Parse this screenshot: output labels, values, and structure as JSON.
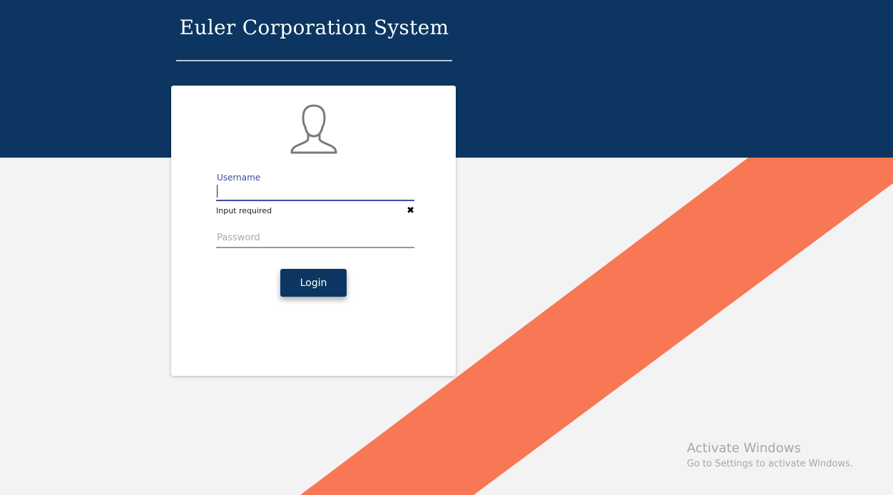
{
  "app": {
    "title": "Euler Corporation System"
  },
  "login_form": {
    "avatar_icon": "user-avatar-icon",
    "username": {
      "label": "Username",
      "value": "",
      "error": "Input required",
      "clear_icon": "close-icon"
    },
    "password": {
      "placeholder": "Password",
      "value": ""
    },
    "login_button": "Login"
  },
  "watermark": {
    "title": "Activate Windows",
    "subtitle": "Go to Settings to activate Windows."
  },
  "colors": {
    "header_band": "#0c3661",
    "stripe": "#f87755",
    "background": "#f3f3f3",
    "accent_underline": "#3f4fa0",
    "button": "#0c3661"
  }
}
